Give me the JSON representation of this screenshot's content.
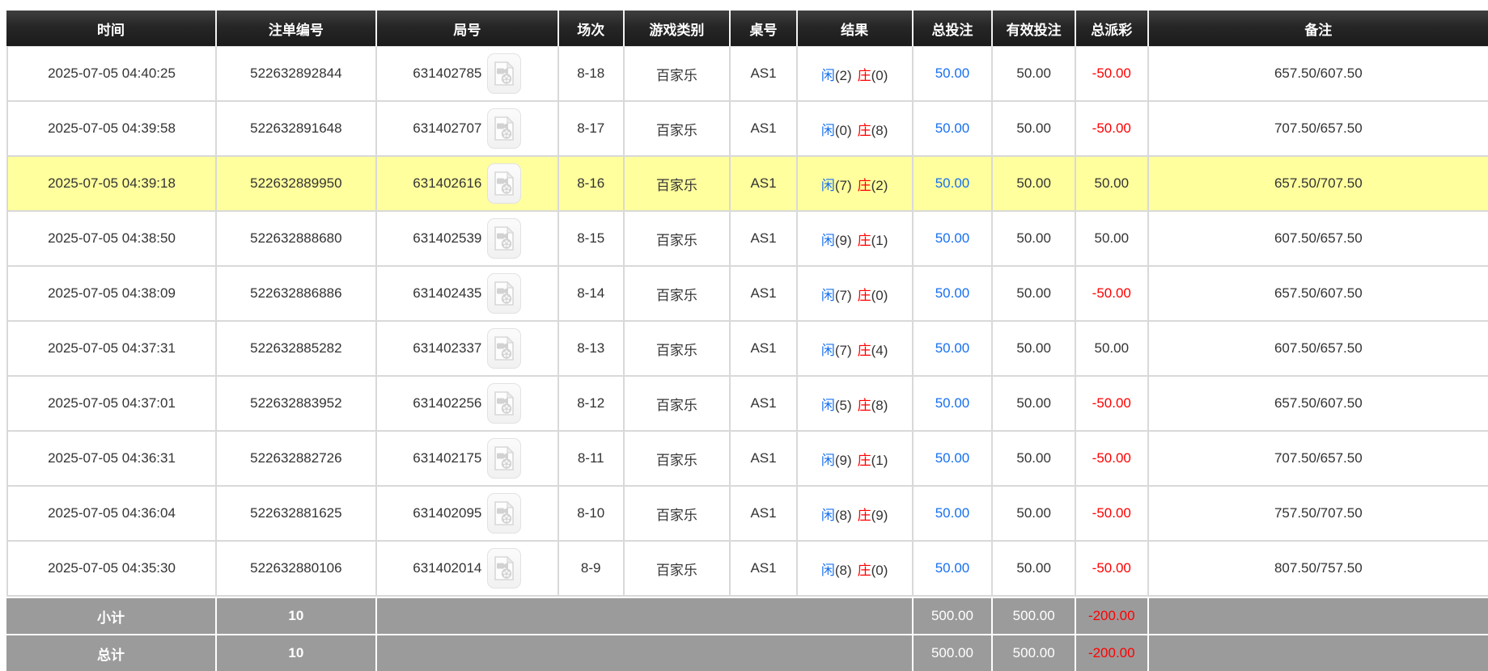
{
  "colors": {
    "header_bg": "#232323",
    "header_text": "#ffffff",
    "body_text": "#333333",
    "link_blue": "#1770f0",
    "loss_red": "#ff0000",
    "player_blue": "#1770f0",
    "banker_red": "#ff0000",
    "highlight_yellow": "#ffff9e",
    "summary_bg": "#9b9b9b",
    "border_gray": "#d9d9d9"
  },
  "icons": {
    "round_video": "video-file-icon"
  },
  "table": {
    "columns": [
      {
        "key": "time",
        "label": "时间"
      },
      {
        "key": "bet-id",
        "label": "注单编号"
      },
      {
        "key": "round-id",
        "label": "局号"
      },
      {
        "key": "session",
        "label": "场次"
      },
      {
        "key": "game-type",
        "label": "游戏类别"
      },
      {
        "key": "table-no",
        "label": "桌号"
      },
      {
        "key": "result",
        "label": "结果"
      },
      {
        "key": "total-bet",
        "label": "总投注"
      },
      {
        "key": "valid-bet",
        "label": "有效投注"
      },
      {
        "key": "total-payout",
        "label": "总派彩"
      },
      {
        "key": "remark",
        "label": "备注"
      }
    ],
    "rows": [
      {
        "time": "2025-07-05 04:40:25",
        "bet_id": "522632892844",
        "round_id": "631402785",
        "session": "8-18",
        "game_type": "百家乐",
        "table_no": "AS1",
        "player_char": "闲",
        "player_score": "(2)",
        "banker_char": "庄",
        "banker_score": "(0)",
        "total_bet": "50.00",
        "valid_bet": "50.00",
        "total_payout": "-50.00",
        "remark": "657.50/607.50",
        "highlighted": false
      },
      {
        "time": "2025-07-05 04:39:58",
        "bet_id": "522632891648",
        "round_id": "631402707",
        "session": "8-17",
        "game_type": "百家乐",
        "table_no": "AS1",
        "player_char": "闲",
        "player_score": "(0)",
        "banker_char": "庄",
        "banker_score": "(8)",
        "total_bet": "50.00",
        "valid_bet": "50.00",
        "total_payout": "-50.00",
        "remark": "707.50/657.50",
        "highlighted": false
      },
      {
        "time": "2025-07-05 04:39:18",
        "bet_id": "522632889950",
        "round_id": "631402616",
        "session": "8-16",
        "game_type": "百家乐",
        "table_no": "AS1",
        "player_char": "闲",
        "player_score": "(7)",
        "banker_char": "庄",
        "banker_score": "(2)",
        "total_bet": "50.00",
        "valid_bet": "50.00",
        "total_payout": "50.00",
        "remark": "657.50/707.50",
        "highlighted": true
      },
      {
        "time": "2025-07-05 04:38:50",
        "bet_id": "522632888680",
        "round_id": "631402539",
        "session": "8-15",
        "game_type": "百家乐",
        "table_no": "AS1",
        "player_char": "闲",
        "player_score": "(9)",
        "banker_char": "庄",
        "banker_score": "(1)",
        "total_bet": "50.00",
        "valid_bet": "50.00",
        "total_payout": "50.00",
        "remark": "607.50/657.50",
        "highlighted": false
      },
      {
        "time": "2025-07-05 04:38:09",
        "bet_id": "522632886886",
        "round_id": "631402435",
        "session": "8-14",
        "game_type": "百家乐",
        "table_no": "AS1",
        "player_char": "闲",
        "player_score": "(7)",
        "banker_char": "庄",
        "banker_score": "(0)",
        "total_bet": "50.00",
        "valid_bet": "50.00",
        "total_payout": "-50.00",
        "remark": "657.50/607.50",
        "highlighted": false
      },
      {
        "time": "2025-07-05 04:37:31",
        "bet_id": "522632885282",
        "round_id": "631402337",
        "session": "8-13",
        "game_type": "百家乐",
        "table_no": "AS1",
        "player_char": "闲",
        "player_score": "(7)",
        "banker_char": "庄",
        "banker_score": "(4)",
        "total_bet": "50.00",
        "valid_bet": "50.00",
        "total_payout": "50.00",
        "remark": "607.50/657.50",
        "highlighted": false
      },
      {
        "time": "2025-07-05 04:37:01",
        "bet_id": "522632883952",
        "round_id": "631402256",
        "session": "8-12",
        "game_type": "百家乐",
        "table_no": "AS1",
        "player_char": "闲",
        "player_score": "(5)",
        "banker_char": "庄",
        "banker_score": "(8)",
        "total_bet": "50.00",
        "valid_bet": "50.00",
        "total_payout": "-50.00",
        "remark": "657.50/607.50",
        "highlighted": false
      },
      {
        "time": "2025-07-05 04:36:31",
        "bet_id": "522632882726",
        "round_id": "631402175",
        "session": "8-11",
        "game_type": "百家乐",
        "table_no": "AS1",
        "player_char": "闲",
        "player_score": "(9)",
        "banker_char": "庄",
        "banker_score": "(1)",
        "total_bet": "50.00",
        "valid_bet": "50.00",
        "total_payout": "-50.00",
        "remark": "707.50/657.50",
        "highlighted": false
      },
      {
        "time": "2025-07-05 04:36:04",
        "bet_id": "522632881625",
        "round_id": "631402095",
        "session": "8-10",
        "game_type": "百家乐",
        "table_no": "AS1",
        "player_char": "闲",
        "player_score": "(8)",
        "banker_char": "庄",
        "banker_score": "(9)",
        "total_bet": "50.00",
        "valid_bet": "50.00",
        "total_payout": "-50.00",
        "remark": "757.50/707.50",
        "highlighted": false
      },
      {
        "time": "2025-07-05 04:35:30",
        "bet_id": "522632880106",
        "round_id": "631402014",
        "session": "8-9",
        "game_type": "百家乐",
        "table_no": "AS1",
        "player_char": "闲",
        "player_score": "(8)",
        "banker_char": "庄",
        "banker_score": "(0)",
        "total_bet": "50.00",
        "valid_bet": "50.00",
        "total_payout": "-50.00",
        "remark": "807.50/757.50",
        "highlighted": false
      }
    ],
    "subtotal": {
      "label": "小计",
      "count": "10",
      "total_bet": "500.00",
      "valid_bet": "500.00",
      "total_payout": "-200.00"
    },
    "total": {
      "label": "总计",
      "count": "10",
      "total_bet": "500.00",
      "valid_bet": "500.00",
      "total_payout": "-200.00"
    }
  }
}
